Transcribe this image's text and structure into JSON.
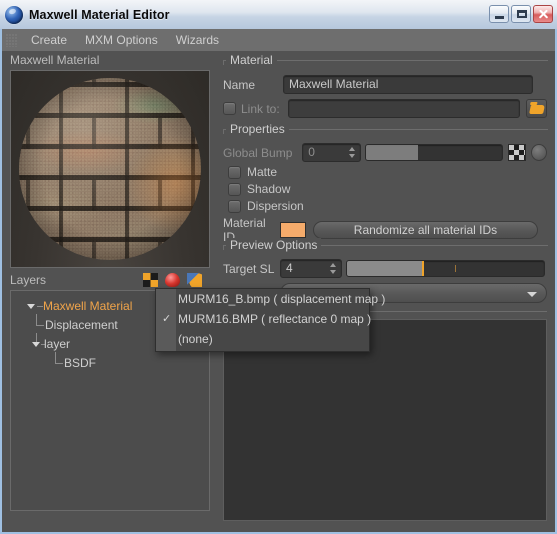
{
  "window": {
    "title": "Maxwell Material Editor",
    "icon": "maxwell-sphere-icon",
    "controls": {
      "minimize": "minimize-button",
      "maximize": "maximize-button",
      "close": "close-button"
    }
  },
  "menubar": {
    "grip": "drag-grip",
    "items": [
      {
        "label": "Create"
      },
      {
        "label": "MXM Options"
      },
      {
        "label": "Wizards"
      }
    ]
  },
  "preview": {
    "label": "Maxwell Material",
    "thumbnail": "brick-material-sphere-preview"
  },
  "layers": {
    "label": "Layers",
    "tools": [
      {
        "name": "add-layer-icon"
      },
      {
        "name": "add-bsdf-icon"
      },
      {
        "name": "add-coating-icon"
      }
    ],
    "tree": [
      {
        "label": "Maxwell Material",
        "depth": 0,
        "accent": true,
        "expander": "open"
      },
      {
        "label": "Displacement",
        "depth": 1,
        "accent": false,
        "expander": "none"
      },
      {
        "label": "layer",
        "depth": 1,
        "accent": false,
        "expander": "open"
      },
      {
        "label": "BSDF",
        "depth": 2,
        "accent": false,
        "expander": "none"
      }
    ]
  },
  "material": {
    "group_title": "Material",
    "name_label": "Name",
    "name_value": "Maxwell Material",
    "link_label": "Link to:",
    "link_value": "",
    "link_checked": false,
    "browse_icon": "folder-open-icon"
  },
  "properties": {
    "group_title": "Properties",
    "global_bump_label": "Global Bump",
    "global_bump_value": "0",
    "global_bump_percent": 38,
    "texture_swatch": "checker-swatch",
    "color_button": "color-circle-button",
    "checkboxes": [
      {
        "label": "Matte",
        "checked": false
      },
      {
        "label": "Shadow",
        "checked": false
      },
      {
        "label": "Dispersion",
        "checked": false
      }
    ],
    "material_id_label": "Material ID",
    "material_id_color": "#f5ab6b",
    "randomize_label": "Randomize all material IDs"
  },
  "preview_options": {
    "group_title": "Preview Options",
    "target_sl_label": "Target SL",
    "target_sl_value": "4",
    "target_sl_percent": 38,
    "target_sl_tick": 55,
    "scene_combo_value": ""
  },
  "dropdown": {
    "items": [
      {
        "label": "MURM16_B.bmp ( displacement map )",
        "checked": false
      },
      {
        "label": "MURM16.BMP ( reflectance 0 map )",
        "checked": true
      },
      {
        "label": "(none)",
        "checked": false
      }
    ],
    "check_glyph": "✓"
  }
}
